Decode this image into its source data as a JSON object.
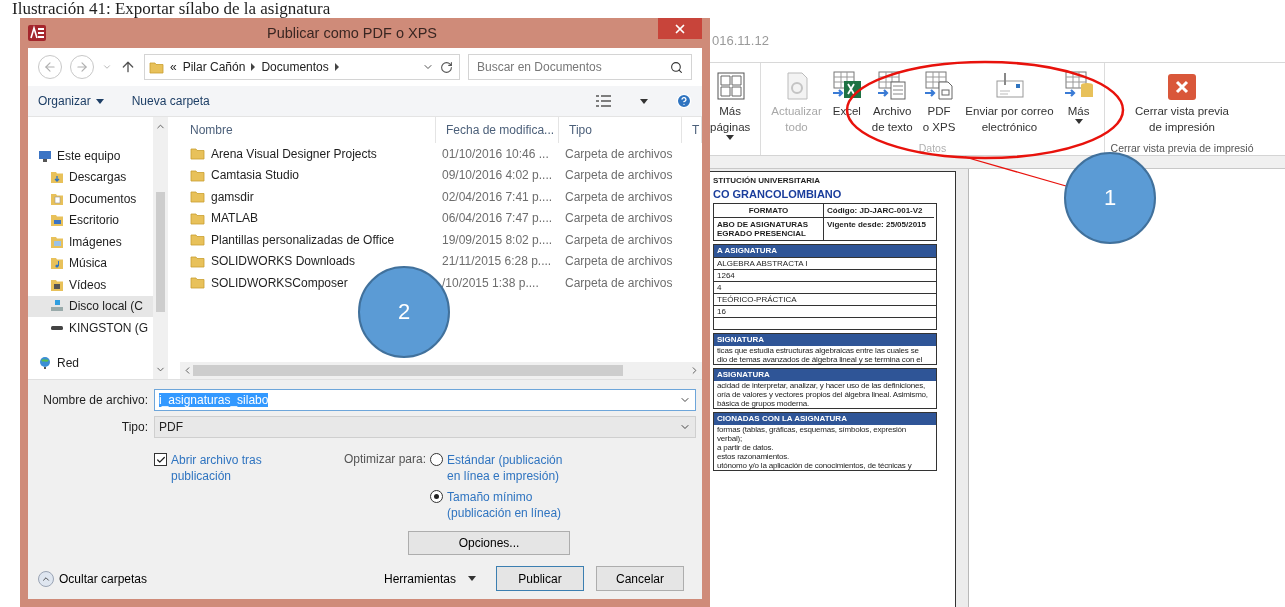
{
  "caption": "Ilustración 41: Exportar sílabo de la asignatura",
  "app": {
    "title_fragment": "016.11.12",
    "ribbon_groups": [
      {
        "buttons": [
          {
            "kind": "pages",
            "lines": [
              "Más",
              "páginas"
            ],
            "caret": true,
            "disabled": false
          }
        ]
      },
      {
        "label": "Datos",
        "buttons": [
          {
            "kind": "refresh",
            "lines": [
              "Actualizar",
              "todo"
            ],
            "caret": false,
            "disabled": true
          },
          {
            "kind": "excel",
            "lines": [
              "Excel"
            ],
            "caret": false,
            "disabled": false
          },
          {
            "kind": "text",
            "lines": [
              "Archivo",
              "de texto"
            ],
            "caret": false,
            "disabled": false
          },
          {
            "kind": "pdf",
            "lines": [
              "PDF",
              "o XPS"
            ],
            "caret": false,
            "disabled": false
          },
          {
            "kind": "mail",
            "lines": [
              "Enviar por correo",
              "electrónico"
            ],
            "caret": false,
            "disabled": false
          },
          {
            "kind": "more",
            "lines": [
              "Más"
            ],
            "caret": true,
            "disabled": false
          }
        ]
      },
      {
        "label": "Cerrar vista previa de impresió",
        "buttons": [
          {
            "kind": "close",
            "lines": [
              "Cerrar vista previa",
              "de impresión"
            ],
            "caret": false,
            "disabled": false
          }
        ]
      }
    ],
    "document": {
      "org_small": "STITUCIÓN UNIVERSITARIA",
      "org_name": "CO GRANCOLOMBIANO",
      "format_table": [
        [
          "FORMATO",
          "Código: JD-JARC-001-V2"
        ],
        [
          "ABO DE ASIGNATURAS EGRADO PRESENCIAL",
          "Vigente desde: 25/05/2015"
        ]
      ],
      "sections": [
        {
          "kind": "rows",
          "heading": "A ASIGNATURA",
          "lines": [
            "ALGEBRA ABSTRACTA I",
            "1264",
            "4",
            "TEÓRICO-PRÁCTICA",
            "16"
          ]
        },
        {
          "kind": "text",
          "heading": "SIGNATURA",
          "lines": [
            "ticas que estudia estructuras algebraicas entre las cuales se",
            "dio de temas avanzados de álgebra lineal y se termina con el"
          ]
        },
        {
          "kind": "text",
          "heading": "ASIGNATURA",
          "lines": [
            "acidad de interpretar, analizar, y hacer uso de las definiciones,",
            "oría de valores y vectores propios del álgebra lineal. Asimismo,",
            "básica de grupos moderna."
          ]
        },
        {
          "kind": "text",
          "heading": "CIONADAS CON LA ASIGNATURA",
          "lines": [
            "formas (tablas, gráficas, esquemas, símbolos, expresión verbal);",
            "a partir de datos.",
            "estos razonamientos.",
            "utónomo y/o la aplicación de conocimientos, de técnicas y"
          ]
        }
      ]
    }
  },
  "dialog": {
    "title": "Publicar como PDF o XPS",
    "breadcrumb_prefix": "«",
    "breadcrumb": [
      "Pilar Cañón",
      "Documentos"
    ],
    "search": {
      "placeholder": "Buscar en Documentos"
    },
    "toolbar": [
      {
        "label": "Organizar",
        "caret": true
      },
      {
        "label": "Nueva carpeta",
        "caret": false
      }
    ],
    "sidebar": [
      {
        "label": "Este equipo",
        "kind": "computer",
        "selected": false,
        "children": [
          {
            "label": "Descargas",
            "kind": "downloads",
            "selected": false
          },
          {
            "label": "Documentos",
            "kind": "documents",
            "selected": false
          },
          {
            "label": "Escritorio",
            "kind": "desktop",
            "selected": false
          },
          {
            "label": "Imágenes",
            "kind": "pictures",
            "selected": false
          },
          {
            "label": "Música",
            "kind": "music",
            "selected": false
          },
          {
            "label": "Vídeos",
            "kind": "videos",
            "selected": false
          },
          {
            "label": "Disco local (C",
            "kind": "disk",
            "selected": true
          },
          {
            "label": "KINGSTON (G",
            "kind": "usb",
            "selected": false
          }
        ]
      },
      {
        "label": "Red",
        "kind": "network",
        "selected": false
      }
    ],
    "columns": [
      "Nombre",
      "Fecha de modifica...",
      "Tipo",
      "T"
    ],
    "rows": [
      {
        "name": "Arena Visual Designer Projects",
        "date": "01/10/2016 10:46 ...",
        "type": "Carpeta de archivos"
      },
      {
        "name": "Camtasia Studio",
        "date": "09/10/2016 4:02 p....",
        "type": "Carpeta de archivos"
      },
      {
        "name": "gamsdir",
        "date": "02/04/2016 7:41 p....",
        "type": "Carpeta de archivos"
      },
      {
        "name": "MATLAB",
        "date": "06/04/2016 7:47 p....",
        "type": "Carpeta de archivos"
      },
      {
        "name": "Plantillas personalizadas de Office",
        "date": "19/09/2015 8:02 p....",
        "type": "Carpeta de archivos"
      },
      {
        "name": "SOLIDWORKS Downloads",
        "date": "21/11/2015 6:28 p....",
        "type": "Carpeta de archivos"
      },
      {
        "name": "SOLIDWORKSComposer",
        "date": "/10/2015 1:38 p....",
        "type": "Carpeta de archivos"
      }
    ],
    "filename": {
      "label": "Nombre de archivo:",
      "value": "i_asignaturas_silabo"
    },
    "filetype": {
      "label": "Tipo:",
      "value": "PDF"
    },
    "open_after": {
      "label": "Abrir archivo tras publicación",
      "checked": true
    },
    "optimize": {
      "label": "Optimizar para:",
      "options": [
        {
          "label": "Estándar (publicación en línea e impresión)",
          "selected": false
        },
        {
          "label": "Tamaño mínimo (publicación en línea)",
          "selected": true
        }
      ]
    },
    "options_button": "Opciones...",
    "hide_folders": "Ocultar carpetas",
    "tools": "Herramientas",
    "buttons": [
      {
        "label": "Publicar",
        "kind": "default"
      },
      {
        "label": "Cancelar",
        "kind": "normal"
      }
    ]
  },
  "annotations": [
    {
      "label": "1"
    },
    {
      "label": "2"
    }
  ]
}
